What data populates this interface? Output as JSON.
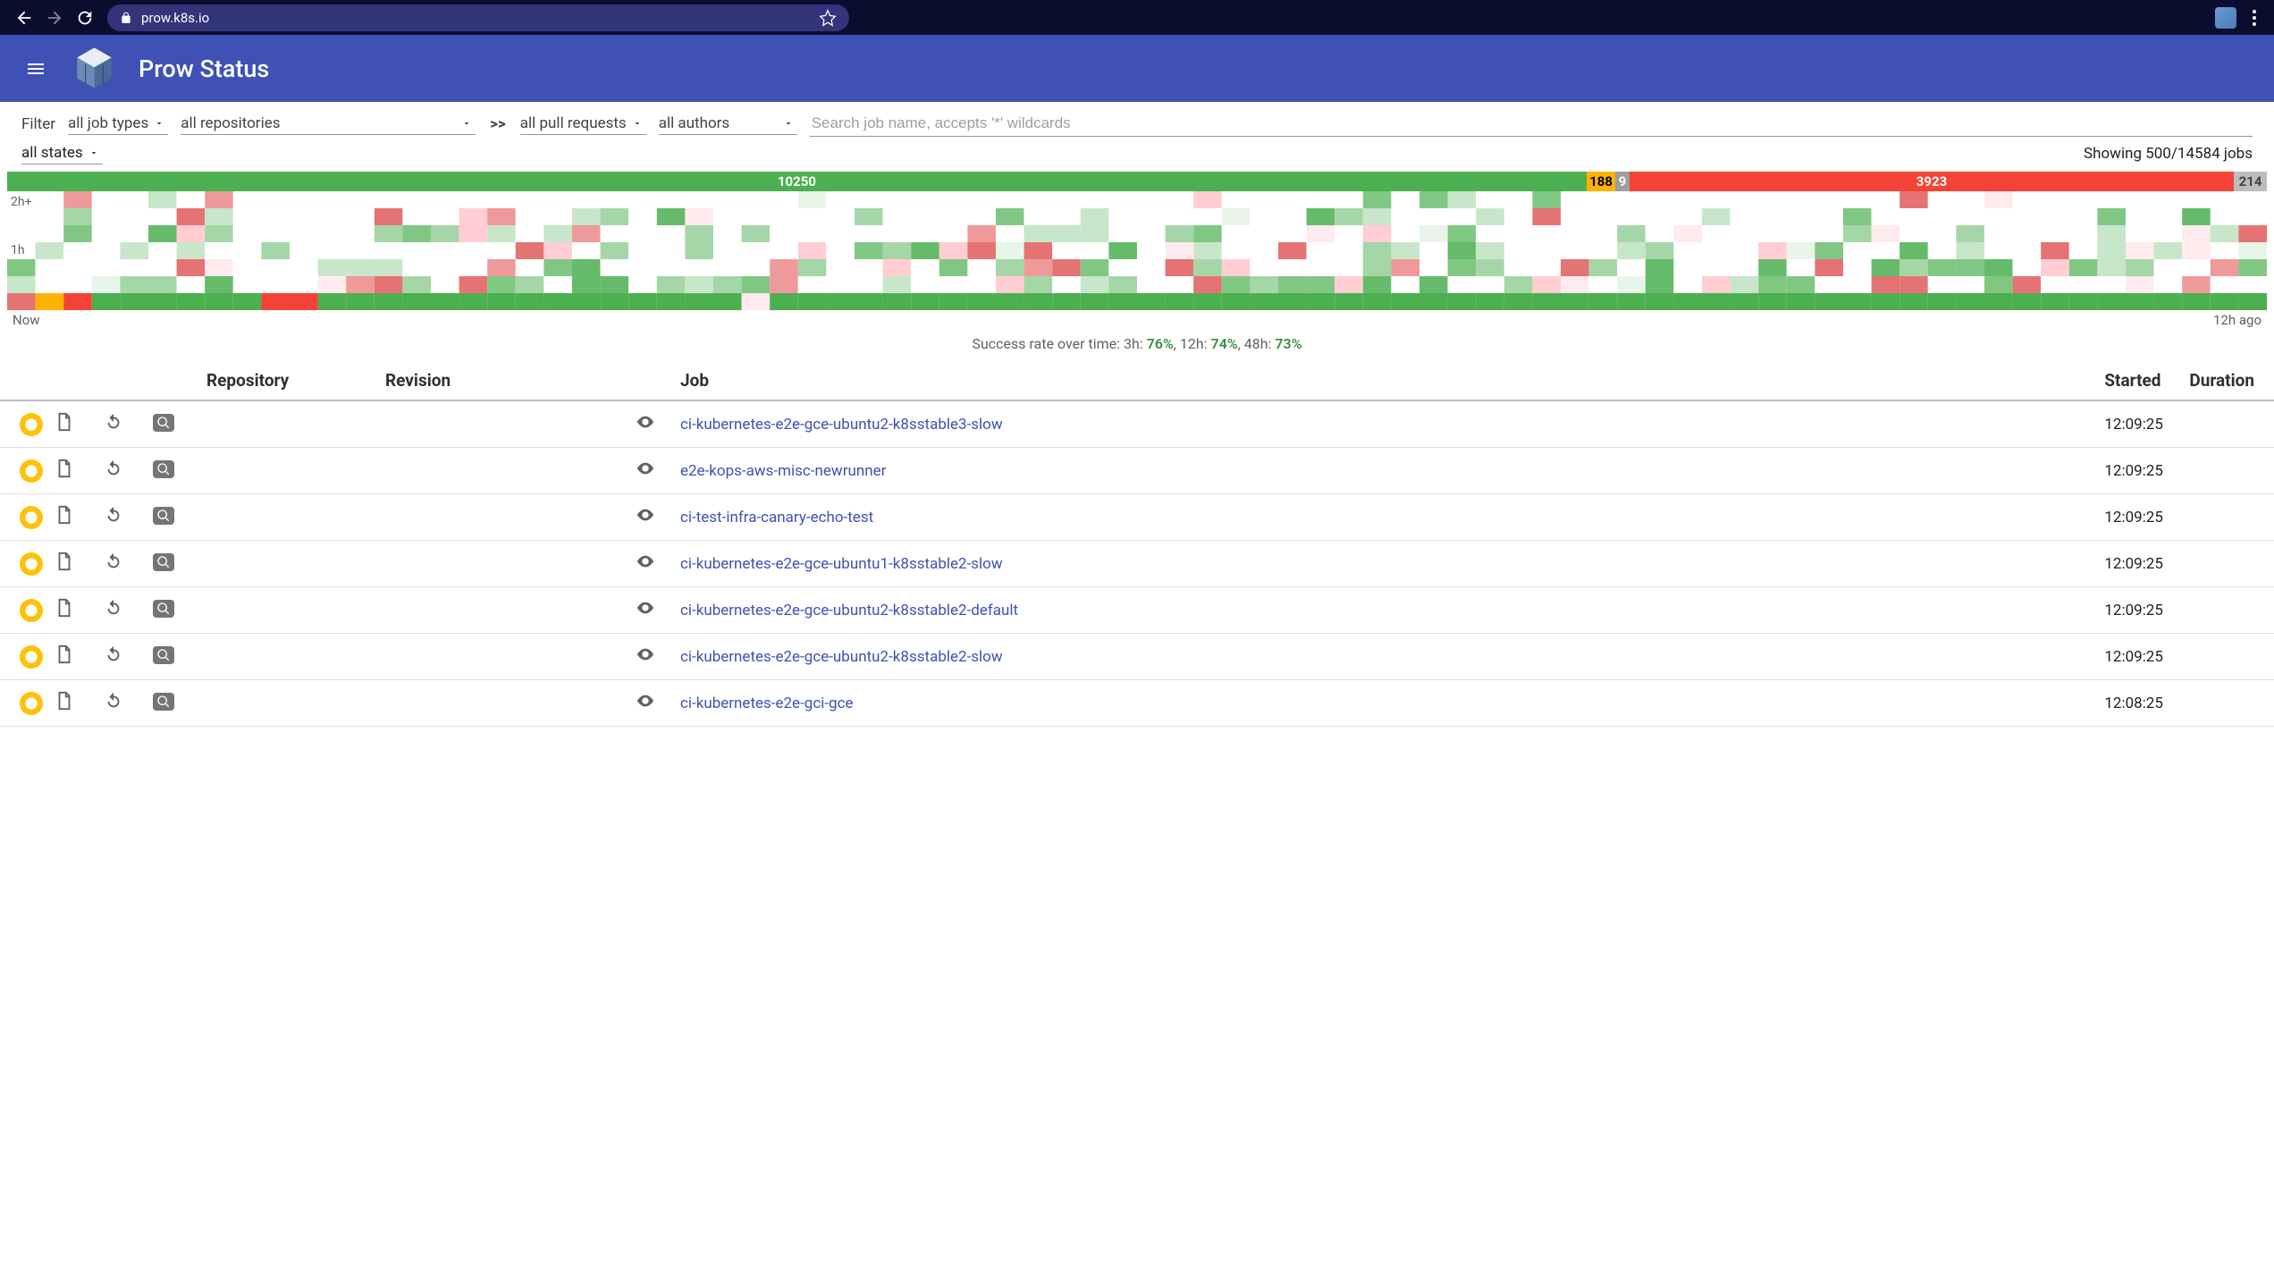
{
  "browser": {
    "url": "prow.k8s.io"
  },
  "header": {
    "title": "Prow Status"
  },
  "filters": {
    "label": "Filter",
    "job_types": "all job types",
    "repositories": "all repositories",
    "separator": ">>",
    "pull_requests": "all pull requests",
    "authors": "all authors",
    "states": "all states",
    "search_placeholder": "Search job name, accepts '*' wildcards",
    "showing": "Showing 500/14584 jobs"
  },
  "summary": {
    "success": 10250,
    "pending": 188,
    "aborted": 9,
    "failure": 3923,
    "other": 214
  },
  "heatmap": {
    "y_top": "2h+",
    "y_mid": "1h",
    "now": "Now",
    "ago": "12h ago"
  },
  "success_rate": {
    "prefix": "Success rate over time: 3h: ",
    "v3h": "76%",
    "sep1": ", 12h: ",
    "v12h": "74%",
    "sep2": ", 48h: ",
    "v48h": "73%"
  },
  "table": {
    "headers": {
      "repo": "Repository",
      "revision": "Revision",
      "job": "Job",
      "started": "Started",
      "duration": "Duration"
    },
    "rows": [
      {
        "job": "ci-kubernetes-e2e-gce-ubuntu2-k8sstable3-slow",
        "started": "12:09:25"
      },
      {
        "job": "e2e-kops-aws-misc-newrunner",
        "started": "12:09:25"
      },
      {
        "job": "ci-test-infra-canary-echo-test",
        "started": "12:09:25"
      },
      {
        "job": "ci-kubernetes-e2e-gce-ubuntu1-k8sstable2-slow",
        "started": "12:09:25"
      },
      {
        "job": "ci-kubernetes-e2e-gce-ubuntu2-k8sstable2-default",
        "started": "12:09:25"
      },
      {
        "job": "ci-kubernetes-e2e-gce-ubuntu2-k8sstable2-slow",
        "started": "12:09:25"
      },
      {
        "job": "ci-kubernetes-e2e-gci-gce",
        "started": "12:08:25"
      }
    ]
  }
}
